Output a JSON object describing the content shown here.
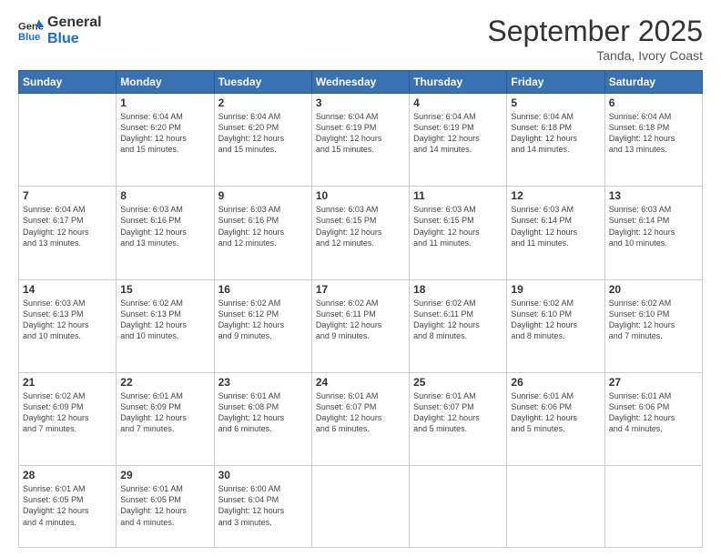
{
  "header": {
    "logo_general": "General",
    "logo_blue": "Blue",
    "month_title": "September 2025",
    "subtitle": "Tanda, Ivory Coast"
  },
  "days_of_week": [
    "Sunday",
    "Monday",
    "Tuesday",
    "Wednesday",
    "Thursday",
    "Friday",
    "Saturday"
  ],
  "weeks": [
    [
      {
        "day": "",
        "info": ""
      },
      {
        "day": "1",
        "info": "Sunrise: 6:04 AM\nSunset: 6:20 PM\nDaylight: 12 hours\nand 15 minutes."
      },
      {
        "day": "2",
        "info": "Sunrise: 6:04 AM\nSunset: 6:20 PM\nDaylight: 12 hours\nand 15 minutes."
      },
      {
        "day": "3",
        "info": "Sunrise: 6:04 AM\nSunset: 6:19 PM\nDaylight: 12 hours\nand 15 minutes."
      },
      {
        "day": "4",
        "info": "Sunrise: 6:04 AM\nSunset: 6:19 PM\nDaylight: 12 hours\nand 14 minutes."
      },
      {
        "day": "5",
        "info": "Sunrise: 6:04 AM\nSunset: 6:18 PM\nDaylight: 12 hours\nand 14 minutes."
      },
      {
        "day": "6",
        "info": "Sunrise: 6:04 AM\nSunset: 6:18 PM\nDaylight: 12 hours\nand 13 minutes."
      }
    ],
    [
      {
        "day": "7",
        "info": "Sunrise: 6:04 AM\nSunset: 6:17 PM\nDaylight: 12 hours\nand 13 minutes."
      },
      {
        "day": "8",
        "info": "Sunrise: 6:03 AM\nSunset: 6:16 PM\nDaylight: 12 hours\nand 13 minutes."
      },
      {
        "day": "9",
        "info": "Sunrise: 6:03 AM\nSunset: 6:16 PM\nDaylight: 12 hours\nand 12 minutes."
      },
      {
        "day": "10",
        "info": "Sunrise: 6:03 AM\nSunset: 6:15 PM\nDaylight: 12 hours\nand 12 minutes."
      },
      {
        "day": "11",
        "info": "Sunrise: 6:03 AM\nSunset: 6:15 PM\nDaylight: 12 hours\nand 11 minutes."
      },
      {
        "day": "12",
        "info": "Sunrise: 6:03 AM\nSunset: 6:14 PM\nDaylight: 12 hours\nand 11 minutes."
      },
      {
        "day": "13",
        "info": "Sunrise: 6:03 AM\nSunset: 6:14 PM\nDaylight: 12 hours\nand 10 minutes."
      }
    ],
    [
      {
        "day": "14",
        "info": "Sunrise: 6:03 AM\nSunset: 6:13 PM\nDaylight: 12 hours\nand 10 minutes."
      },
      {
        "day": "15",
        "info": "Sunrise: 6:02 AM\nSunset: 6:13 PM\nDaylight: 12 hours\nand 10 minutes."
      },
      {
        "day": "16",
        "info": "Sunrise: 6:02 AM\nSunset: 6:12 PM\nDaylight: 12 hours\nand 9 minutes."
      },
      {
        "day": "17",
        "info": "Sunrise: 6:02 AM\nSunset: 6:11 PM\nDaylight: 12 hours\nand 9 minutes."
      },
      {
        "day": "18",
        "info": "Sunrise: 6:02 AM\nSunset: 6:11 PM\nDaylight: 12 hours\nand 8 minutes."
      },
      {
        "day": "19",
        "info": "Sunrise: 6:02 AM\nSunset: 6:10 PM\nDaylight: 12 hours\nand 8 minutes."
      },
      {
        "day": "20",
        "info": "Sunrise: 6:02 AM\nSunset: 6:10 PM\nDaylight: 12 hours\nand 7 minutes."
      }
    ],
    [
      {
        "day": "21",
        "info": "Sunrise: 6:02 AM\nSunset: 6:09 PM\nDaylight: 12 hours\nand 7 minutes."
      },
      {
        "day": "22",
        "info": "Sunrise: 6:01 AM\nSunset: 6:09 PM\nDaylight: 12 hours\nand 7 minutes."
      },
      {
        "day": "23",
        "info": "Sunrise: 6:01 AM\nSunset: 6:08 PM\nDaylight: 12 hours\nand 6 minutes."
      },
      {
        "day": "24",
        "info": "Sunrise: 6:01 AM\nSunset: 6:07 PM\nDaylight: 12 hours\nand 6 minutes."
      },
      {
        "day": "25",
        "info": "Sunrise: 6:01 AM\nSunset: 6:07 PM\nDaylight: 12 hours\nand 5 minutes."
      },
      {
        "day": "26",
        "info": "Sunrise: 6:01 AM\nSunset: 6:06 PM\nDaylight: 12 hours\nand 5 minutes."
      },
      {
        "day": "27",
        "info": "Sunrise: 6:01 AM\nSunset: 6:06 PM\nDaylight: 12 hours\nand 4 minutes."
      }
    ],
    [
      {
        "day": "28",
        "info": "Sunrise: 6:01 AM\nSunset: 6:05 PM\nDaylight: 12 hours\nand 4 minutes."
      },
      {
        "day": "29",
        "info": "Sunrise: 6:01 AM\nSunset: 6:05 PM\nDaylight: 12 hours\nand 4 minutes."
      },
      {
        "day": "30",
        "info": "Sunrise: 6:00 AM\nSunset: 6:04 PM\nDaylight: 12 hours\nand 3 minutes."
      },
      {
        "day": "",
        "info": ""
      },
      {
        "day": "",
        "info": ""
      },
      {
        "day": "",
        "info": ""
      },
      {
        "day": "",
        "info": ""
      }
    ]
  ]
}
